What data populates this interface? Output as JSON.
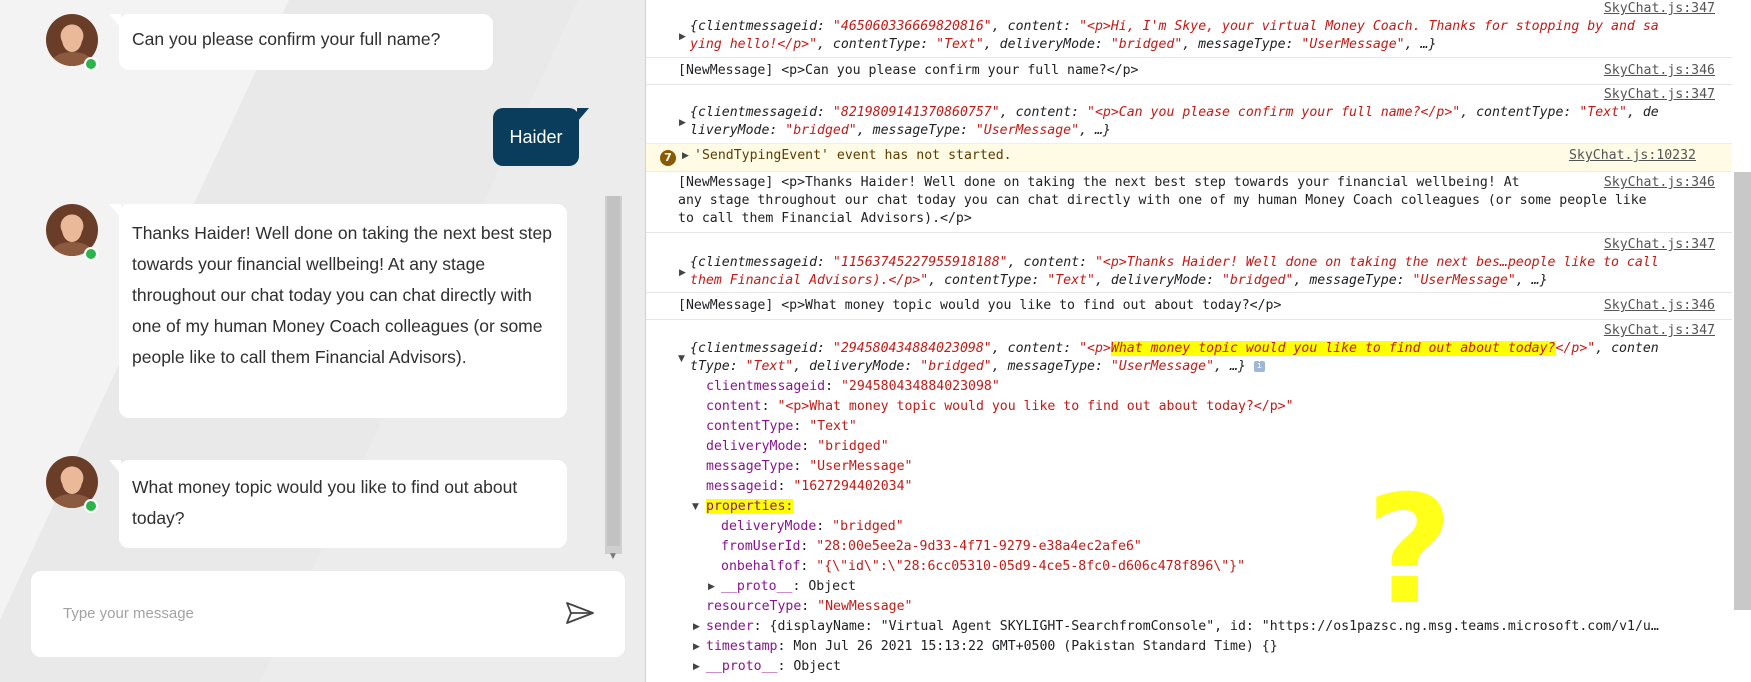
{
  "chat": {
    "messages": [
      {
        "text": "Can you please confirm your full name?"
      },
      {
        "text": "Thanks Haider! Well done on taking the next best step towards your financial wellbeing! At any stage throughout our chat today you can chat directly with one of my human Money Coach colleagues (or some people like to call them Financial Advisors)."
      },
      {
        "text": "What money topic would you like to find out about today?"
      }
    ],
    "user_message": "Haider",
    "composer_placeholder": "Type your message"
  },
  "console": {
    "lines": [
      {
        "src": "SkyChat.js:347"
      },
      {
        "src": "SkyChat.js:346",
        "text": "[NewMessage] <p>Can you please confirm your full name?</p>"
      },
      {
        "src": "SkyChat.js:347"
      },
      {
        "src": "SkyChat.js:10232",
        "warn_count": "7",
        "warn_text": "'SendTypingEvent' event has not started."
      },
      {
        "src": "SkyChat.js:346",
        "text_1": "[NewMessage] <p>Thanks Haider! Well done on taking the next best step towards your financial wellbeing! At",
        "text_2": "any stage throughout our chat today you can chat directly with one of my human Money Coach colleagues (or some people like",
        "text_3": "to call them Financial Advisors).</p>"
      },
      {
        "src": "SkyChat.js:347"
      },
      {
        "src": "SkyChat.js:346",
        "text": "[NewMessage] <p>What money topic would you like to find out about today?</p>"
      },
      {
        "src": "SkyChat.js:347"
      }
    ],
    "obj1": {
      "id": "465060336669820816",
      "content": "<p>Hi, I'm Skye, your virtual Money Coach. Thanks for stopping by and sa",
      "content2": "ying hello!</p>"
    },
    "obj2": {
      "id": "8219809141370860757",
      "content": "<p>Can you please confirm your full name?</p>"
    },
    "obj3": {
      "id": "11563745227955918188",
      "content": "<p>Thanks Haider! Well done on taking the next bes…people like to call",
      "content2": "them Financial Advisors).</p>"
    },
    "obj4": {
      "id": "294580434884023098",
      "content_pre": "<p>",
      "content_hl": "What money topic would you like to find out about today?",
      "content_post": "</p>",
      "expanded": {
        "clientmessageid": "\"294580434884023098\"",
        "content": "\"<p>What money topic would you like to find out about today?</p>\"",
        "contentType": "\"Text\"",
        "deliveryMode": "\"bridged\"",
        "messageType": "\"UserMessage\"",
        "messageid": "\"1627294402034\"",
        "properties_label": "properties:",
        "prop_deliveryMode": "\"bridged\"",
        "prop_fromUserId": "\"28:00e5ee2a-9d33-4f71-9279-e38a4ec2afe6\"",
        "prop_onbehalfof": "\"{\\\"id\\\":\\\"28:6cc05310-05d9-4ce5-8fc0-d606c478f896\\\"}\"",
        "proto_object": "Object",
        "resourceType": "\"NewMessage\"",
        "sender": "{displayName: \"Virtual Agent SKYLIGHT-SearchfromConsole\", id: \"https://os1pazsc.ng.msg.teams.microsoft.com/v1/u…",
        "timestamp": "Mon Jul 26 2021 15:13:22 GMT+0500 (Pakistan Standard Time) {}",
        "proto_object2": "Object"
      }
    },
    "common": {
      "contentType": "\"Text\"",
      "deliveryMode": "\"bridged\"",
      "messageType": "\"UserMessage\"",
      "ellipsis": "…"
    },
    "annotation": "?"
  }
}
